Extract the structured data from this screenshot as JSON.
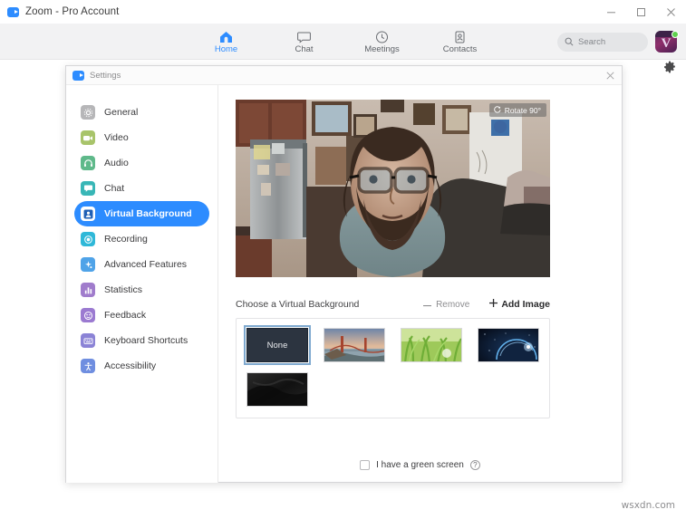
{
  "window": {
    "title": "Zoom - Pro Account",
    "logo_icon": "zoom-camera-icon",
    "minimize_label": "Minimize",
    "maximize_label": "Maximize",
    "close_label": "Close"
  },
  "navbar": {
    "items": [
      {
        "label": "Home",
        "icon": "home-icon",
        "active": true
      },
      {
        "label": "Chat",
        "icon": "chat-bubble-icon",
        "active": false
      },
      {
        "label": "Meetings",
        "icon": "clock-icon",
        "active": false
      },
      {
        "label": "Contacts",
        "icon": "contact-card-icon",
        "active": false
      }
    ],
    "search": {
      "placeholder": "Search",
      "icon": "search-icon"
    },
    "avatar": {
      "letter": "V",
      "status": "available",
      "status_color": "#5ed04d"
    },
    "settings_gear_icon": "gear-icon",
    "accent_color": "#2d8cff"
  },
  "settings": {
    "title": "Settings",
    "icon": "zoom-camera-icon",
    "close_label": "Close",
    "sidebar": [
      {
        "label": "General",
        "icon": "gear-icon",
        "color": "#b6b6b8",
        "selected": false
      },
      {
        "label": "Video",
        "icon": "video-camera-icon",
        "color": "#a8c46a",
        "selected": false
      },
      {
        "label": "Audio",
        "icon": "headphone-icon",
        "color": "#5fb98a",
        "selected": false
      },
      {
        "label": "Chat",
        "icon": "chat-bubble-icon",
        "color": "#38b6b6",
        "selected": false
      },
      {
        "label": "Virtual Background",
        "icon": "person-frame-icon",
        "color": "#2d8cff",
        "selected": true
      },
      {
        "label": "Recording",
        "icon": "record-dot-icon",
        "color": "#2fb8d8",
        "selected": false
      },
      {
        "label": "Advanced Features",
        "icon": "sparkle-icon",
        "color": "#4fa3e8",
        "selected": false
      },
      {
        "label": "Statistics",
        "icon": "bar-chart-icon",
        "color": "#a07ccc",
        "selected": false
      },
      {
        "label": "Feedback",
        "icon": "smiley-icon",
        "color": "#9b7ad1",
        "selected": false
      },
      {
        "label": "Keyboard Shortcuts",
        "icon": "keyboard-icon",
        "color": "#8b83d6",
        "selected": false
      },
      {
        "label": "Accessibility",
        "icon": "accessibility-icon",
        "color": "#6f8ee0",
        "selected": false
      }
    ],
    "preview": {
      "rotate_label": "Rotate 90°",
      "rotate_icon": "rotate-icon",
      "description": "Webcam preview of a bearded man wearing glasses in a kitchen and living room"
    },
    "virtual_background": {
      "heading": "Choose a Virtual Background",
      "remove_label": "Remove",
      "remove_icon": "minus-icon",
      "add_label": "Add Image",
      "add_icon": "plus-icon",
      "thumbnails": [
        {
          "label": "None",
          "type": "none",
          "selected": true
        },
        {
          "label": "",
          "type": "bridge",
          "selected": false
        },
        {
          "label": "",
          "type": "grass",
          "selected": false
        },
        {
          "label": "",
          "type": "earth",
          "selected": false
        },
        {
          "label": "",
          "type": "dark",
          "selected": false
        }
      ]
    },
    "green_screen": {
      "label": "I have a green screen",
      "checked": false,
      "help_icon": "question-mark-icon",
      "help_glyph": "?"
    }
  },
  "watermark": {
    "text": "wsxdn.com"
  }
}
